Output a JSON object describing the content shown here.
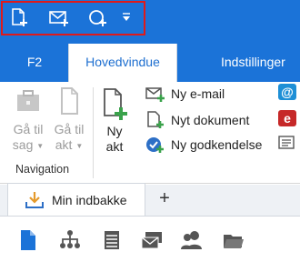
{
  "quick_access": {
    "items": [
      {
        "icon": "new-document-icon"
      },
      {
        "icon": "new-email-icon"
      },
      {
        "icon": "new-approval-icon"
      },
      {
        "icon": "customize-dropdown-icon"
      }
    ]
  },
  "tabs": [
    {
      "label": "F2"
    },
    {
      "label": "Hovedvindue"
    },
    {
      "label": "Indstillinger"
    }
  ],
  "ribbon": {
    "navigation": {
      "goto_case_line1": "Gå til",
      "goto_case_line2": "sag",
      "goto_act_line1": "Gå til",
      "goto_act_line2": "akt",
      "group_label": "Navigation"
    },
    "new_act": {
      "line1": "Ny",
      "line2": "akt"
    },
    "new_email": "Ny e-mail",
    "new_document": "Nyt dokument",
    "new_approval": "Ny godkendelse"
  },
  "document_tab": {
    "label": "Min indbakke"
  },
  "colors": {
    "accent": "#1b73d8",
    "highlight": "#e01a1a",
    "green": "#3aa24b"
  }
}
